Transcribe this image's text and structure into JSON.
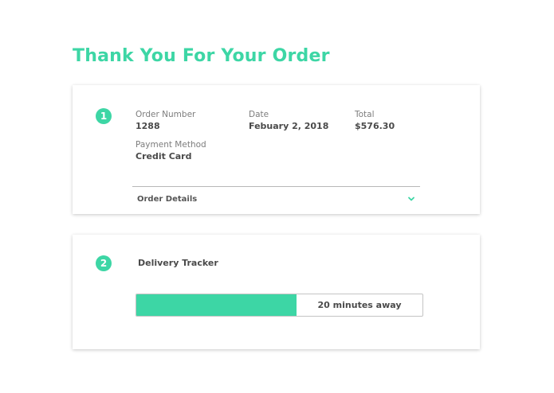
{
  "header": {
    "title": "Thank You For Your Order"
  },
  "order_card": {
    "step": "1",
    "order_number": {
      "label": "Order Number",
      "value": "1288"
    },
    "date": {
      "label": "Date",
      "value": "Febuary 2, 2018"
    },
    "total": {
      "label": "Total",
      "value": "$576.30"
    },
    "payment_method": {
      "label": "Payment Method",
      "value": "Credit Card"
    },
    "details_toggle": {
      "label": "Order Details",
      "icon": "chevron-down-icon"
    }
  },
  "delivery_card": {
    "step": "2",
    "title": "Delivery Tracker",
    "progress": {
      "fraction": 0.56,
      "status": "20 minutes away"
    }
  },
  "colors": {
    "accent": "#3dd6a5",
    "text": "#4a4a4a",
    "muted": "#7d7d7d"
  }
}
